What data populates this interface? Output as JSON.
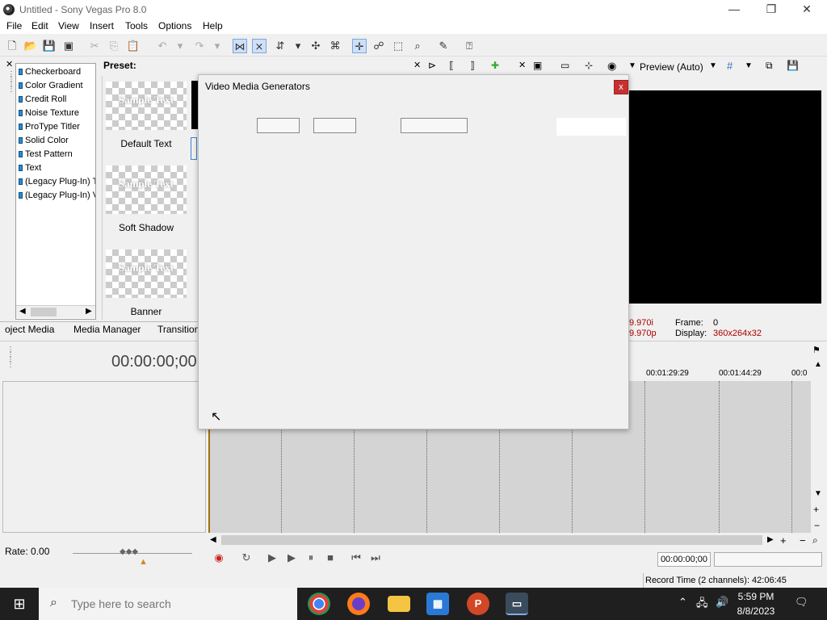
{
  "window": {
    "title": "Untitled - Sony Vegas Pro 8.0",
    "minimize": "—",
    "maximize": "❐",
    "close": "✕"
  },
  "menu": [
    "File",
    "Edit",
    "View",
    "Insert",
    "Tools",
    "Options",
    "Help"
  ],
  "generators": [
    "Checkerboard",
    "Color Gradient",
    "Credit Roll",
    "Noise Texture",
    "ProType Titler",
    "Solid Color",
    "Test Pattern",
    "Text",
    "(Legacy Plug-In) T",
    "(Legacy Plug-In) V"
  ],
  "preset": {
    "label": "Preset:",
    "items": [
      {
        "thumb_text": "Sample Text",
        "name": "Default Text"
      },
      {
        "thumb_text": "Sample Text",
        "name": "Soft Shadow"
      },
      {
        "thumb_text": "Sample Text",
        "name": "Banner"
      }
    ]
  },
  "tabs": [
    "oject Media",
    "Media Manager",
    "Transitions"
  ],
  "preview": {
    "mode": "Preview (Auto)",
    "fps1": "9.970i",
    "fps2": "9.970p",
    "frame_label": "Frame:",
    "frame_value": "0",
    "display_label": "Display:",
    "display_value": "360x264x32"
  },
  "timeline": {
    "timecode": "00:00:00;00",
    "ruler": [
      "00:01:29:29",
      "00:01:44:29",
      "00:0"
    ],
    "rate": "Rate: 0.00",
    "position": "00:00:00;00",
    "record_time": "Record Time (2 channels): 42:06:45"
  },
  "dialog": {
    "title": "Video Media Generators",
    "close": "x"
  },
  "taskbar": {
    "search_placeholder": "Type here to search",
    "time": "5:59 PM",
    "date": "8/8/2023"
  }
}
